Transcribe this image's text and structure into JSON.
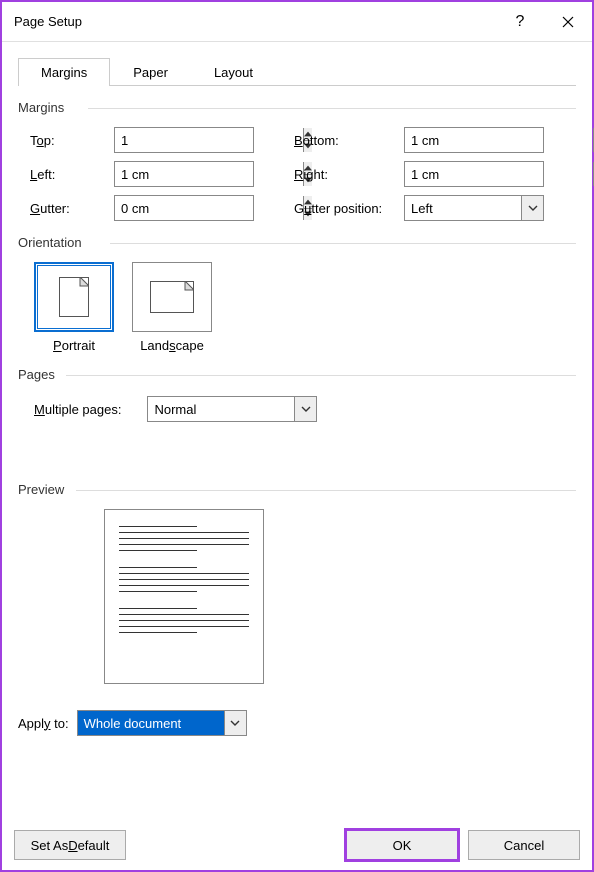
{
  "window": {
    "title": "Page Setup"
  },
  "tabs": {
    "margins": "Margins",
    "paper": "Paper",
    "layout": "Layout"
  },
  "margins": {
    "section": "Margins",
    "top_label_pre": "T",
    "top_label_u": "o",
    "top_label_post": "p:",
    "top_value": "1",
    "bottom_label_u": "B",
    "bottom_label_post": "ottom:",
    "bottom_value": "1 cm",
    "left_label_u": "L",
    "left_label_post": "eft:",
    "left_value": "1 cm",
    "right_label_u": "R",
    "right_label_post": "ight:",
    "right_value": "1 cm",
    "gutter_label_u": "G",
    "gutter_label_post": "utter:",
    "gutter_value": "0 cm",
    "gutterpos_label_pre": "G",
    "gutterpos_label_u": "u",
    "gutterpos_label_post": "tter position:",
    "gutterpos_value": "Left"
  },
  "orientation": {
    "section": "Orientation",
    "portrait_u": "P",
    "portrait_post": "ortrait",
    "landscape_pre": "Land",
    "landscape_u": "s",
    "landscape_post": "cape"
  },
  "pages": {
    "section": "Pages",
    "multi_label_u": "M",
    "multi_label_post": "ultiple pages:",
    "multi_value": "Normal"
  },
  "preview": {
    "section": "Preview"
  },
  "apply": {
    "label_pre": "Appl",
    "label_u": "y",
    "label_post": " to:",
    "value": "Whole document"
  },
  "buttons": {
    "default_pre": "Set As ",
    "default_u": "D",
    "default_post": "efault",
    "ok": "OK",
    "cancel": "Cancel"
  }
}
